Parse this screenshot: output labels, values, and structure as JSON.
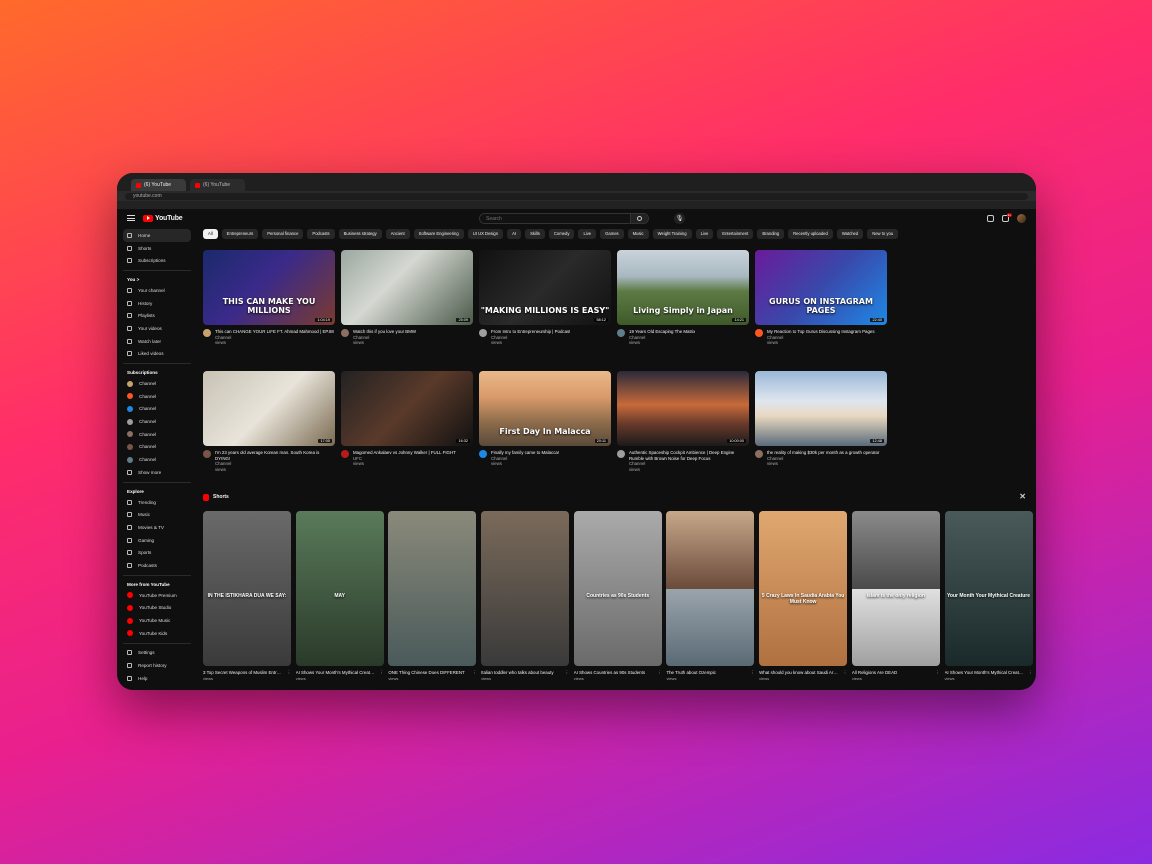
{
  "browser": {
    "tabs": [
      {
        "label": "(6) YouTube"
      },
      {
        "label": "(6) YouTube"
      }
    ],
    "url": "youtube.com"
  },
  "header": {
    "logo_text": "YouTube",
    "search_placeholder": "Search",
    "notification_count": "9+"
  },
  "sidebar": {
    "main": [
      {
        "label": "Home",
        "icon": "home-icon",
        "active": true
      },
      {
        "label": "Shorts",
        "icon": "shorts-icon"
      },
      {
        "label": "Subscriptions",
        "icon": "subscriptions-icon"
      }
    ],
    "you_heading": "You  >",
    "you": [
      {
        "label": "Your channel",
        "icon": "channel-icon"
      },
      {
        "label": "History",
        "icon": "history-icon"
      },
      {
        "label": "Playlists",
        "icon": "playlists-icon"
      },
      {
        "label": "Your videos",
        "icon": "videos-icon"
      },
      {
        "label": "Watch later",
        "icon": "watch-later-icon"
      },
      {
        "label": "Liked videos",
        "icon": "liked-icon"
      }
    ],
    "subs_heading": "Subscriptions",
    "subscriptions": [
      {
        "label": "Channel",
        "color": "#c9a26b"
      },
      {
        "label": "Channel",
        "color": "#ff5722"
      },
      {
        "label": "Channel",
        "color": "#1e88e5"
      },
      {
        "label": "Channel",
        "color": "#9e9e9e"
      },
      {
        "label": "Channel",
        "color": "#8d6e63"
      },
      {
        "label": "Channel",
        "color": "#795548"
      },
      {
        "label": "Channel",
        "color": "#607d8b"
      }
    ],
    "show_more": "Show more",
    "explore_heading": "Explore",
    "explore": [
      {
        "label": "Trending",
        "icon": "trending-icon"
      },
      {
        "label": "Music",
        "icon": "music-icon"
      },
      {
        "label": "Movies & TV",
        "icon": "movies-icon"
      },
      {
        "label": "Gaming",
        "icon": "gaming-icon"
      },
      {
        "label": "Sports",
        "icon": "sports-icon"
      },
      {
        "label": "Podcasts",
        "icon": "podcasts-icon"
      }
    ],
    "more_heading": "More from YouTube",
    "more": [
      {
        "label": "YouTube Premium"
      },
      {
        "label": "YouTube Studio"
      },
      {
        "label": "YouTube Music"
      },
      {
        "label": "YouTube Kids"
      }
    ],
    "bottom": [
      {
        "label": "Settings",
        "icon": "settings-icon"
      },
      {
        "label": "Report history",
        "icon": "flag-icon"
      },
      {
        "label": "Help",
        "icon": "help-icon"
      }
    ]
  },
  "chips": [
    "All",
    "Entrepreneurs",
    "Personal finance",
    "Podcasts",
    "Business strategy",
    "Ancient",
    "Software Engineering",
    "UI UX Design",
    "AI",
    "Skills",
    "Comedy",
    "Live",
    "Games",
    "Music",
    "Weight Training",
    "Live",
    "Entertainment",
    "Branding",
    "Recently uploaded",
    "Watched",
    "New to you"
  ],
  "videos": [
    {
      "title": "This can CHANGE YOUR LIFE FT. Ahmad Mahmood | EP.88",
      "channel": "Channel",
      "stats": "views",
      "duration": "1:04:19",
      "bg": "linear-gradient(135deg,#1a2a6c,#3b2a8a 45%,#7a3b2e)",
      "overlay": "THIS CAN MAKE YOU MILLIONS",
      "av": "#c9a26b"
    },
    {
      "title": "Watch this if you love your BMW",
      "channel": "Channel",
      "stats": "views",
      "duration": "25:09",
      "bg": "linear-gradient(135deg,#9aa7a0,#d5d8d2 40%,#4a5a4a)",
      "overlay": "",
      "av": "#8d6e63"
    },
    {
      "title": "From Intro to Entrepreneurship | Podcast",
      "channel": "Channel",
      "stats": "views",
      "duration": "58:12",
      "bg": "linear-gradient(135deg,#111,#2a2a2a 50%,#111)",
      "overlay": "\"MAKING MILLIONS IS EASY\"",
      "av": "#9e9e9e"
    },
    {
      "title": "19 Years Old Escaping The Matrix",
      "channel": "Channel",
      "stats": "views",
      "duration": "14:21",
      "bg": "linear-gradient(180deg,#c9d3dc 0%,#a9b8c0 35%,#5d7a44 55%,#3f5a2a 100%)",
      "overlay": "Living Simply in Japan",
      "av": "#607d8b"
    },
    {
      "title": "My Reaction to Top Gurus Discussing Instagram Pages",
      "channel": "Channel",
      "stats": "views",
      "duration": "22:40",
      "bg": "linear-gradient(135deg,#6a1b9a,#3949ab 50%,#1e88e5)",
      "overlay": "GURUS ON INSTAGRAM PAGES",
      "av": "#ff5722"
    },
    {
      "title": "I'm 23 years old average Korean man. South Korea is DYING!",
      "channel": "Channel",
      "stats": "views",
      "duration": "17:05",
      "bg": "linear-gradient(135deg,#c8c2b4,#e8e4da 50%,#7a6a50)",
      "overlay": "",
      "av": "#795548"
    },
    {
      "title": "Magomed Ankalaev vs Johnny Walker | FULL FIGHT",
      "channel": "UFC",
      "stats": "views",
      "duration": "16:32",
      "bg": "linear-gradient(135deg,#222,#5a3a2a 50%,#111)",
      "overlay": "",
      "av": "#b71c1c"
    },
    {
      "title": "Finally my family came to Malacca!",
      "channel": "Channel",
      "stats": "views",
      "duration": "20:11",
      "bg": "linear-gradient(180deg,#e9b98a 0%,#d99a6a 35%,#8a6a4a 70%,#5a4a3a 100%)",
      "overlay": "First Day In Malacca",
      "av": "#1e88e5"
    },
    {
      "title": "Authentic Spaceship Cockpit Ambience | Deep Engine Rumble with Brown Noise for Deep Focus",
      "channel": "Channel",
      "stats": "views",
      "duration": "10:00:00",
      "bg": "linear-gradient(180deg,#2a2a3a 0%,#c76a3a 45%,#6a3a2a 70%,#1a1a1a 100%)",
      "overlay": "",
      "av": "#9e9e9e"
    },
    {
      "title": "the reality of making $30k per month as a growth operator",
      "channel": "Channel",
      "stats": "views",
      "duration": "12:48",
      "bg": "linear-gradient(180deg,#9ab8d8 0%,#dfe6ee 40%,#e8d8c0 60%,#5a6a7a 100%)",
      "overlay": "",
      "av": "#8d6e63"
    }
  ],
  "shorts_heading": "Shorts",
  "shorts": [
    {
      "title": "3 Top Secret Weapons of Muslim Entrepreneurs",
      "views": "views",
      "bg": "linear-gradient(180deg,#6a6a6a,#3a3a3a)",
      "text": "IN THE ISTIKHARA DUA WE SAY:",
      "split": false
    },
    {
      "title": "AI Shows Your Month's Mythical Creature",
      "views": "views",
      "bg": "linear-gradient(180deg,#5a7a5a,#2a3a2a)",
      "text": "MAY",
      "split": false
    },
    {
      "title": "ONE Thing Chinese Does DIFFERENT",
      "views": "views",
      "bg": "linear-gradient(180deg,#8a8a7a,#4a5a5a)",
      "text": "",
      "split": false
    },
    {
      "title": "Italian toddler who talks about beauty",
      "views": "views",
      "bg": "linear-gradient(180deg,#7a6a5a,#3a3a3a)",
      "text": "",
      "split": false
    },
    {
      "title": "AI Shows Countries as 90s Students",
      "views": "views",
      "bg": "linear-gradient(180deg,#aaa,#6a6a6a)",
      "text": "Countries as 90s Students",
      "split": false
    },
    {
      "title": "The Truth about Ozempic",
      "views": "views",
      "bg": "linear-gradient(180deg,#c8a88a,#6a4a3a)",
      "bg2": "linear-gradient(180deg,#9aa4ac,#5a6a74)",
      "text": "",
      "split": true
    },
    {
      "title": "What should you know about Saudi Arabia?",
      "views": "views",
      "bg": "linear-gradient(180deg,#e0a870,#b07040)",
      "text": "5 Crazy Laws In Saudia Arabia You Must Know",
      "split": false
    },
    {
      "title": "All Religions Are DEAD",
      "views": "views",
      "bg": "linear-gradient(180deg,#8a8a8a,#4a4a4a)",
      "bg2": "linear-gradient(180deg,#e0e0e0,#a0a0a0)",
      "text": "islam is the only religion",
      "split": true
    },
    {
      "title": "AI Shows Your Month's Mythical Creature",
      "views": "views",
      "bg": "linear-gradient(180deg,#4a5a5a,#1a2a2a)",
      "text": "Your Month Your Mythical Creature",
      "split": false
    }
  ]
}
